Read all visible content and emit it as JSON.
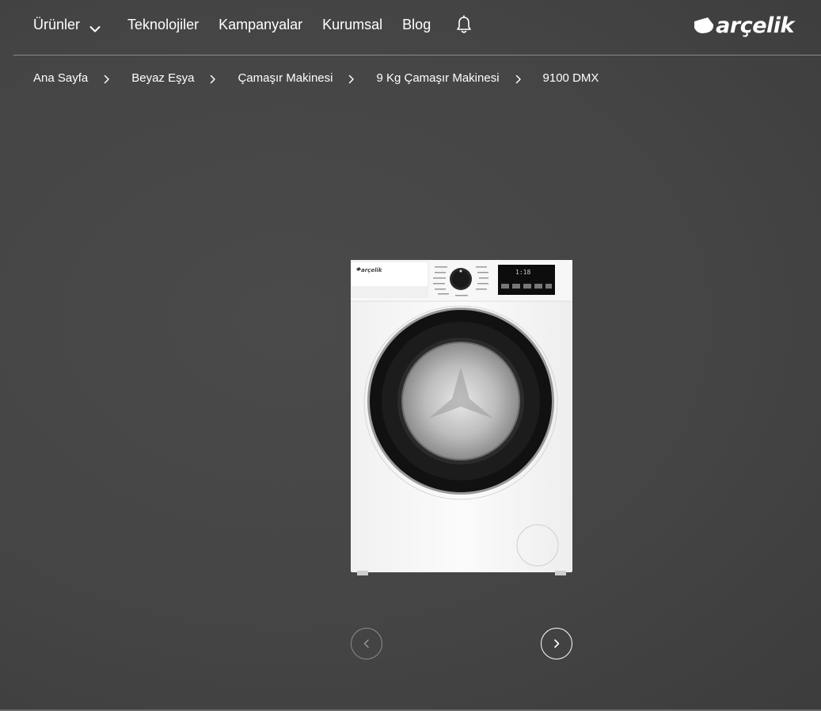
{
  "header": {
    "nav": {
      "products_label": "Ürünler",
      "links": [
        "Teknolojiler",
        "Kampanyalar",
        "Kurumsal",
        "Blog"
      ]
    },
    "icons": {
      "dropdown": "chevron-down-icon",
      "notifications": "bell-icon"
    },
    "logo_text": "arçelik"
  },
  "breadcrumb": {
    "items": [
      "Ana Sayfa",
      "Beyaz Eşya",
      "Çamaşır Makinesi",
      "9 Kg Çamaşır Makinesi",
      "9100 DMX"
    ]
  },
  "product": {
    "image_alt": "9100 DMX washing machine",
    "brand_on_panel": "arçelik"
  },
  "carousel": {
    "prev_icon": "chevron-left-icon",
    "next_icon": "chevron-right-icon"
  },
  "colors": {
    "background": "#464646",
    "text": "#ffffff",
    "divider": "#8a8a8a"
  }
}
